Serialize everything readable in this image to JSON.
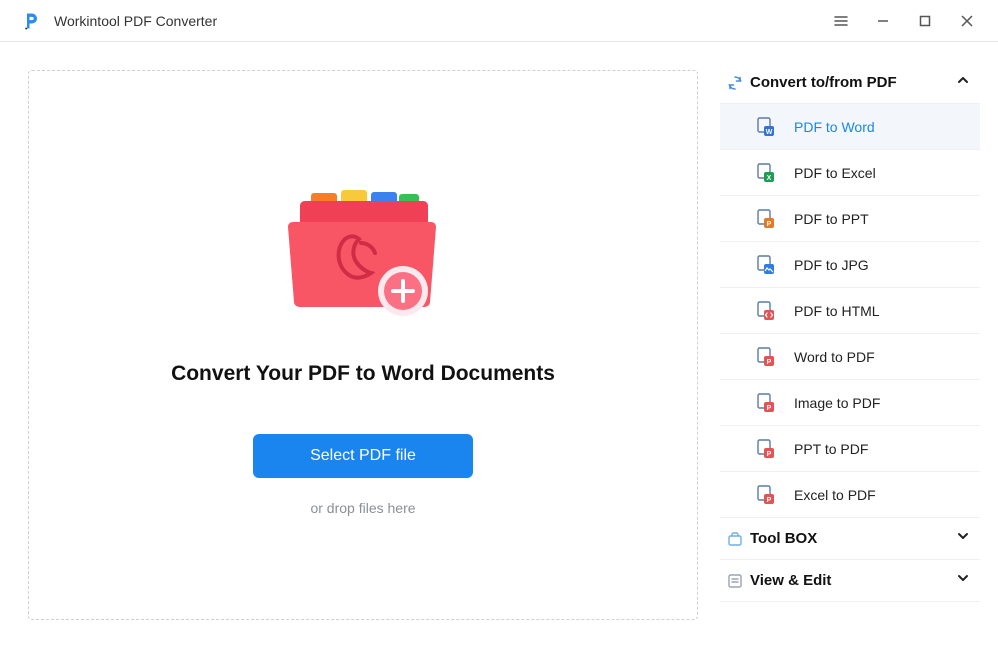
{
  "app": {
    "title": "Workintool PDF Converter"
  },
  "main": {
    "heading": "Convert Your PDF to Word Documents",
    "select_button": "Select PDF file",
    "drop_hint": "or drop files here"
  },
  "sidebar": {
    "sections": [
      {
        "icon": "convert-cycle-icon",
        "label": "Convert to/from PDF",
        "expanded": true,
        "items": [
          {
            "icon": "word-badge-icon",
            "color": "#3173d6",
            "label": "PDF to Word",
            "active": true
          },
          {
            "icon": "excel-badge-icon",
            "color": "#1d9f53",
            "label": "PDF to Excel"
          },
          {
            "icon": "ppt-badge-icon",
            "color": "#e07a2c",
            "label": "PDF to PPT"
          },
          {
            "icon": "jpg-badge-icon",
            "color": "#2f7de1",
            "label": "PDF to JPG"
          },
          {
            "icon": "html-badge-icon",
            "color": "#e45353",
            "label": "PDF to HTML"
          },
          {
            "icon": "to-pdf-icon",
            "color": "#e45353",
            "label": "Word to PDF"
          },
          {
            "icon": "to-pdf-icon",
            "color": "#e45353",
            "label": "Image to PDF"
          },
          {
            "icon": "to-pdf-icon",
            "color": "#e45353",
            "label": "PPT to PDF"
          },
          {
            "icon": "to-pdf-icon",
            "color": "#e45353",
            "label": "Excel to PDF"
          }
        ]
      },
      {
        "icon": "toolbox-icon",
        "label": "Tool BOX",
        "expanded": false
      },
      {
        "icon": "view-edit-icon",
        "label": "View & Edit",
        "expanded": false
      }
    ]
  }
}
